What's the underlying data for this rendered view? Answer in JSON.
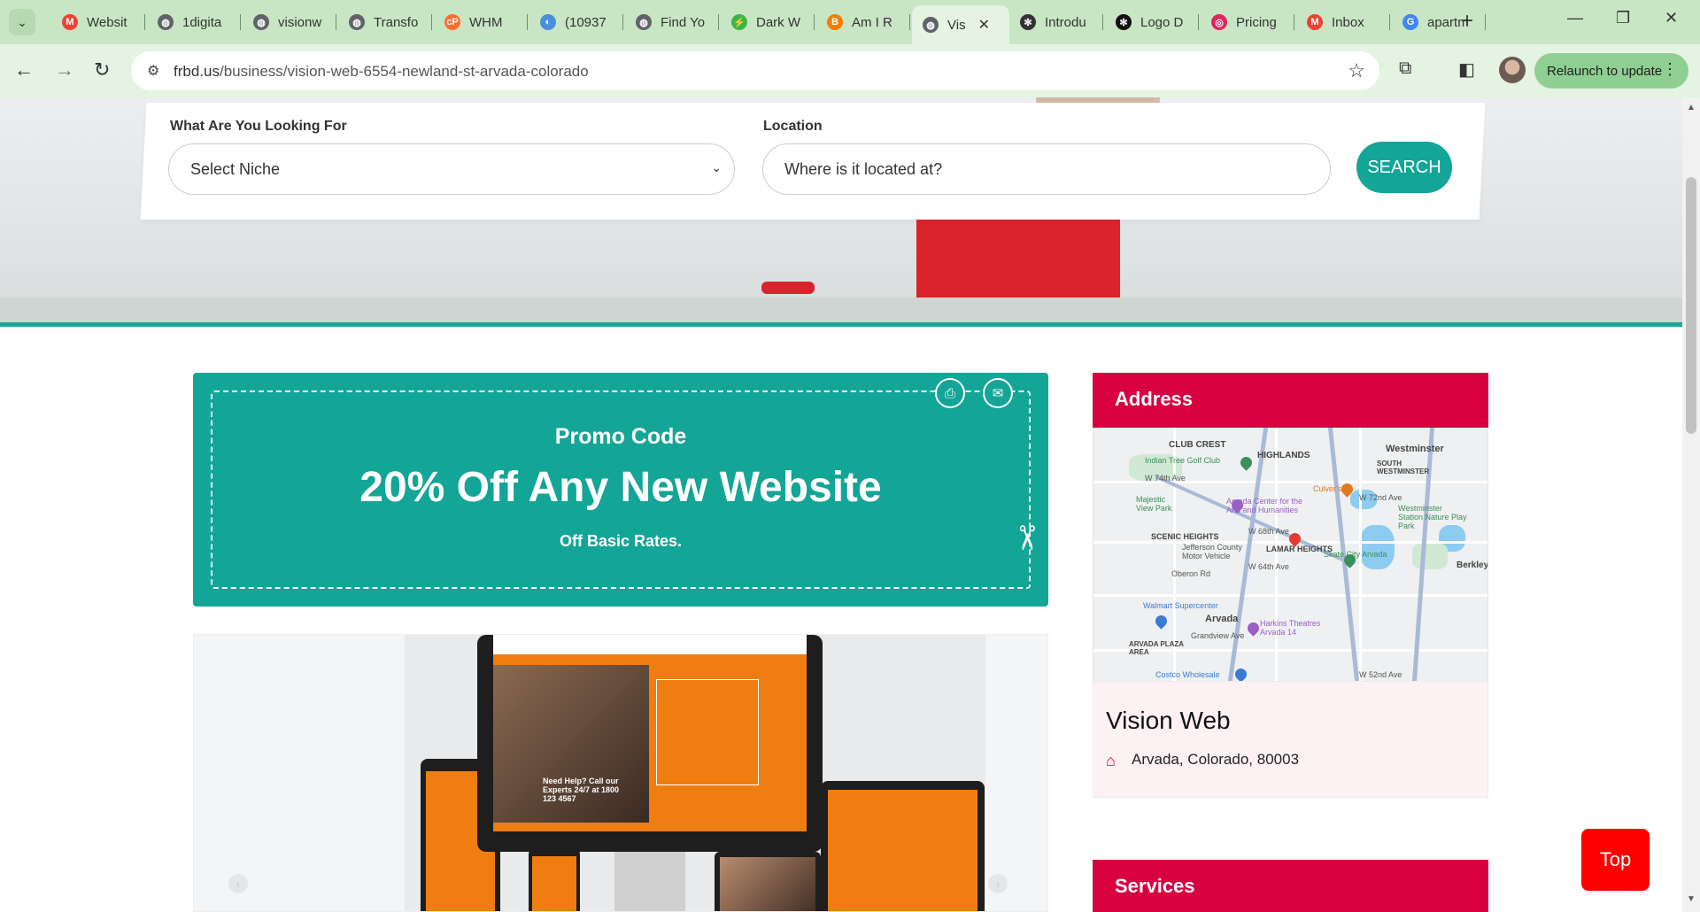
{
  "browser": {
    "tabs": [
      {
        "label": "Websit",
        "icon": "gmail-icon",
        "color": "#ea4335"
      },
      {
        "label": "1digita",
        "icon": "globe-icon",
        "color": "#5f6368"
      },
      {
        "label": "visionw",
        "icon": "globe-icon",
        "color": "#5f6368"
      },
      {
        "label": "Transfo",
        "icon": "globe-icon",
        "color": "#5f6368"
      },
      {
        "label": "WHM",
        "icon": "cpanel-icon",
        "color": "#ff6c2c"
      },
      {
        "label": "(10937",
        "icon": "chat-icon",
        "color": "#4a90d9"
      },
      {
        "label": "Find Yo",
        "icon": "globe-icon",
        "color": "#5f6368"
      },
      {
        "label": "Dark W",
        "icon": "bolt-icon",
        "color": "#3bb54a"
      },
      {
        "label": "Am I R",
        "icon": "blogger-icon",
        "color": "#f57d00"
      },
      {
        "label": "Vis",
        "icon": "globe-icon",
        "color": "#5f6368"
      },
      {
        "label": "Introdu",
        "icon": "openai-icon",
        "color": "#333333"
      },
      {
        "label": "Logo D",
        "icon": "openai-icon",
        "color": "#111111"
      },
      {
        "label": "Pricing",
        "icon": "target-icon",
        "color": "#e0245e"
      },
      {
        "label": "Inbox",
        "icon": "gmail-icon",
        "color": "#ea4335"
      },
      {
        "label": "apartm",
        "icon": "google-icon",
        "color": "#4285f4"
      }
    ],
    "active_tab_index": 9,
    "url_host": "frbd.us",
    "url_path": "/business/vision-web-6554-newland-st-arvada-colorado",
    "relaunch_label": "Relaunch to update"
  },
  "search": {
    "niche_label": "What Are You Looking For",
    "niche_value": "Select Niche",
    "location_label": "Location",
    "location_placeholder": "Where is it located at?",
    "button_label": "SEARCH"
  },
  "promo": {
    "subtitle": "Promo Code",
    "title": "20% Off Any New Website",
    "note": "Off Basic Rates."
  },
  "gallery": {
    "mockup_text": "Need Help? Call our Experts 24/7 at 1800 123 4567"
  },
  "address": {
    "heading": "Address",
    "business_name": "Vision Web",
    "location": "Arvada, Colorado, 80003",
    "map_labels": {
      "club_crest": "CLUB CREST",
      "highlands": "HIGHLANDS",
      "westminster": "Westminster",
      "south_westminster": "SOUTH WESTMINSTER",
      "indian_tree": "Indian Tree Golf Club",
      "w74": "W 74th Ave",
      "majestic": "Majestic View Park",
      "arvada_center": "Arvada Center for the Arts and Humanities",
      "culvers": "Culver's",
      "w72": "W 72nd Ave",
      "wm_station": "Westminster Station Nature Play Park",
      "scenic": "SCENIC HEIGHTS",
      "jeffco": "Jefferson County Motor Vehicle",
      "w68": "W 68th Ave",
      "lamar": "LAMAR HEIGHTS",
      "skate": "Skate City Arvada",
      "berkley": "Berkley",
      "w64": "W 64th Ave",
      "oberon": "Oberon Rd",
      "walmart": "Walmart Supercenter",
      "arvada": "Arvada",
      "harkins": "Harkins Theatres Arvada 14",
      "grandview": "Grandview Ave",
      "plaza": "ARVADA PLAZA AREA",
      "costco": "Costco Wholesale",
      "w52": "W 52nd Ave"
    }
  },
  "services": {
    "heading": "Services"
  },
  "top_button": "Top",
  "colors": {
    "teal": "#13a596",
    "crimson": "#d8003f",
    "top_red": "#ff0000"
  }
}
